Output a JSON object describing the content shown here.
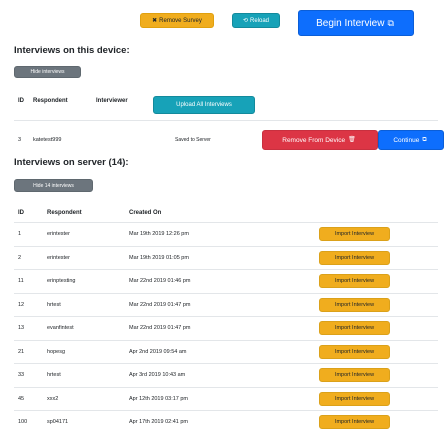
{
  "toolbar": {
    "remove_survey": "Remove Survey",
    "reload": "Reload",
    "begin_interview": "Begin Interview"
  },
  "device": {
    "heading": "Interviews on this device:",
    "hide_button": "Hide interviews",
    "headers": [
      "ID",
      "Respondent",
      "Interviewer"
    ],
    "upload_all": "Upload All Interviews",
    "rows": [
      {
        "id": "3",
        "respondent": "katetest999",
        "interviewer": "",
        "status": "Saved to Server",
        "remove": "Remove From Device",
        "continue": "Continue"
      }
    ]
  },
  "server": {
    "heading": "Interviews on server (14):",
    "hide_button": "Hide 14 interviews",
    "headers": [
      "ID",
      "Respondent",
      "Created On"
    ],
    "import_label": "Import Interview",
    "rows": [
      {
        "id": "1",
        "respondent": "erintester",
        "created": "Mar 19th 2019 12:26 pm"
      },
      {
        "id": "2",
        "respondent": "erintester",
        "created": "Mar 19th 2019 01:05 pm"
      },
      {
        "id": "11",
        "respondent": "erinptesting",
        "created": "Mar 22nd 2019 01:46 pm"
      },
      {
        "id": "12",
        "respondent": "hrtest",
        "created": "Mar 22nd 2019 01:47 pm"
      },
      {
        "id": "13",
        "respondent": "evanfintest",
        "created": "Mar 22nd 2019 01:47 pm"
      },
      {
        "id": "21",
        "respondent": "hopesg",
        "created": "Apr 2nd 2019 09:54 am"
      },
      {
        "id": "33",
        "respondent": "hrtest",
        "created": "Apr 3rd 2019 10:43 am"
      },
      {
        "id": "45",
        "respondent": "xxx2",
        "created": "Apr 12th 2019 03:17 pm"
      },
      {
        "id": "100",
        "respondent": "sp04171",
        "created": "Apr 17th 2019 02:41 pm"
      }
    ]
  },
  "colors": {
    "warning": "#f0ad1e",
    "info": "#17a2b8",
    "primary": "#0d6efd",
    "secondary": "#6c757d",
    "danger": "#dc3545"
  },
  "icons": [
    "x-icon",
    "refresh-icon",
    "external-link-icon",
    "trash-icon"
  ]
}
